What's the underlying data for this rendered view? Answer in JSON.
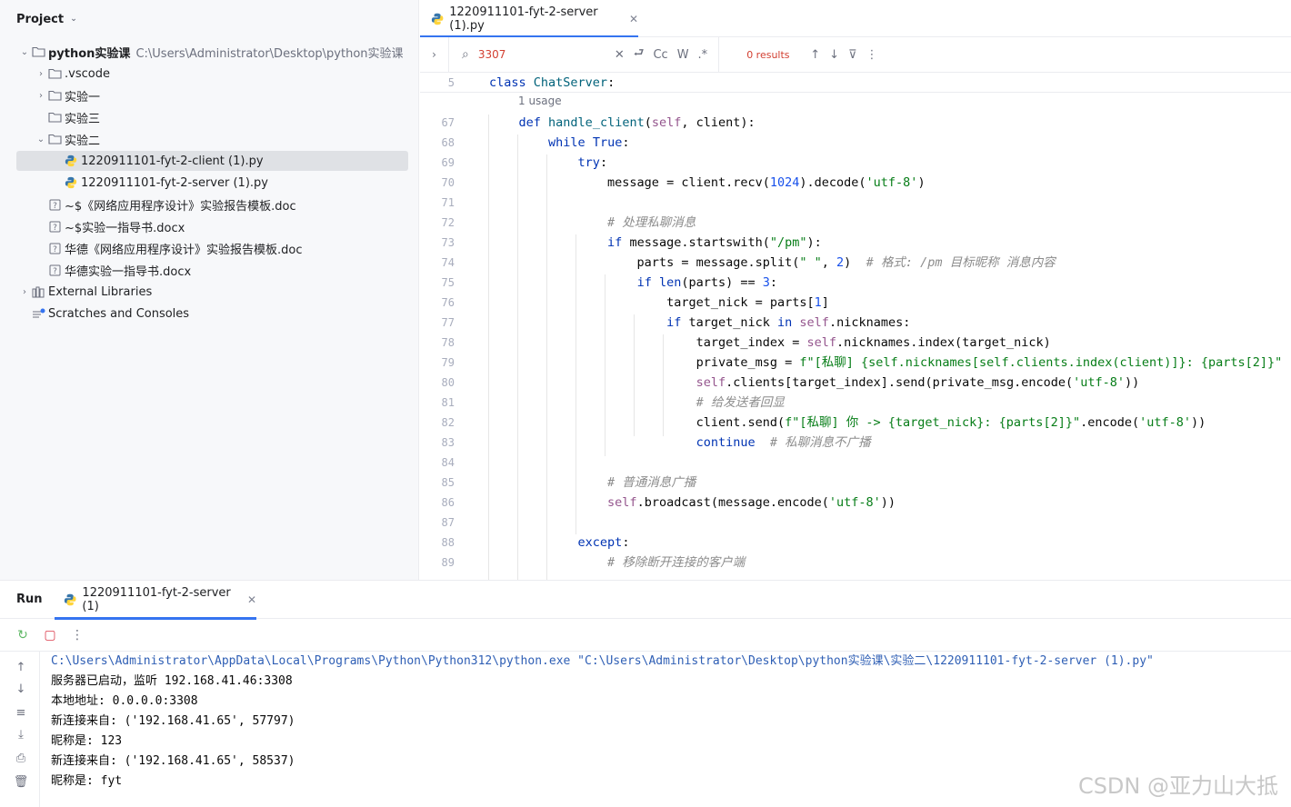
{
  "project": {
    "title": "Project",
    "tree": [
      {
        "label": "python实验课",
        "path": "C:\\Users\\Administrator\\Desktop\\python实验课",
        "icon": "folder-icon",
        "arrow": "down",
        "indent": 0,
        "bold": true
      },
      {
        "label": ".vscode",
        "icon": "folder-icon",
        "arrow": "right",
        "indent": 1
      },
      {
        "label": "实验一",
        "icon": "folder-icon",
        "arrow": "right",
        "indent": 1
      },
      {
        "label": "实验三",
        "icon": "folder-icon",
        "arrow": "none",
        "indent": 1
      },
      {
        "label": "实验二",
        "icon": "folder-icon",
        "arrow": "down",
        "indent": 1
      },
      {
        "label": "1220911101-fyt-2-client (1).py",
        "icon": "python-file-icon",
        "arrow": "none",
        "indent": 2,
        "selected": true
      },
      {
        "label": "1220911101-fyt-2-server (1).py",
        "icon": "python-file-icon",
        "arrow": "none",
        "indent": 2
      },
      {
        "label": "~$《网络应用程序设计》实验报告模板.doc",
        "icon": "unknown-file-icon",
        "arrow": "none",
        "indent": 1
      },
      {
        "label": "~$实验一指导书.docx",
        "icon": "unknown-file-icon",
        "arrow": "none",
        "indent": 1
      },
      {
        "label": "华德《网络应用程序设计》实验报告模板.doc",
        "icon": "unknown-file-icon",
        "arrow": "none",
        "indent": 1
      },
      {
        "label": "华德实验一指导书.docx",
        "icon": "unknown-file-icon",
        "arrow": "none",
        "indent": 1
      },
      {
        "label": "External Libraries",
        "icon": "library-icon",
        "arrow": "right",
        "indent": 0
      },
      {
        "label": "Scratches and Consoles",
        "icon": "scratches-icon",
        "arrow": "none",
        "indent": 0
      }
    ]
  },
  "editor": {
    "tab_label": "1220911101-fyt-2-server (1).py",
    "search": {
      "query": "3307",
      "results": "0 results",
      "match_case": "Cc",
      "words": "W",
      "regex": ".*"
    },
    "usage_hint": "1 usage",
    "sticky_line": {
      "num": "5",
      "code": "class ChatServer:"
    },
    "lines": [
      {
        "num": "67",
        "code": "    def handle_client(self, client):"
      },
      {
        "num": "68",
        "code": "        while True:"
      },
      {
        "num": "69",
        "code": "            try:"
      },
      {
        "num": "70",
        "code": "                message = client.recv(1024).decode('utf-8')"
      },
      {
        "num": "71",
        "code": ""
      },
      {
        "num": "72",
        "code": "                # 处理私聊消息"
      },
      {
        "num": "73",
        "code": "                if message.startswith(\"/pm\"):"
      },
      {
        "num": "74",
        "code": "                    parts = message.split(\" \", 2)  # 格式: /pm 目标昵称 消息内容"
      },
      {
        "num": "75",
        "code": "                    if len(parts) == 3:"
      },
      {
        "num": "76",
        "code": "                        target_nick = parts[1]"
      },
      {
        "num": "77",
        "code": "                        if target_nick in self.nicknames:"
      },
      {
        "num": "78",
        "code": "                            target_index = self.nicknames.index(target_nick)"
      },
      {
        "num": "79",
        "code": "                            private_msg = f\"[私聊] {self.nicknames[self.clients.index(client)]}: {parts[2]}\""
      },
      {
        "num": "80",
        "code": "                            self.clients[target_index].send(private_msg.encode('utf-8'))"
      },
      {
        "num": "81",
        "code": "                            # 给发送者回显"
      },
      {
        "num": "82",
        "code": "                            client.send(f\"[私聊] 你 -> {target_nick}: {parts[2]}\".encode('utf-8'))"
      },
      {
        "num": "83",
        "code": "                            continue  # 私聊消息不广播"
      },
      {
        "num": "84",
        "code": ""
      },
      {
        "num": "85",
        "code": "                # 普通消息广播"
      },
      {
        "num": "86",
        "code": "                self.broadcast(message.encode('utf-8'))"
      },
      {
        "num": "87",
        "code": ""
      },
      {
        "num": "88",
        "code": "            except:"
      },
      {
        "num": "89",
        "code": "                # 移除断开连接的客户端"
      }
    ]
  },
  "run": {
    "title": "Run",
    "tab_label": "1220911101-fyt-2-server (1)",
    "console": [
      "C:\\Users\\Administrator\\AppData\\Local\\Programs\\Python\\Python312\\python.exe \"C:\\Users\\Administrator\\Desktop\\python实验课\\实验二\\1220911101-fyt-2-server (1).py\"",
      "服务器已启动，监听 192.168.41.46:3308",
      "本地地址: 0.0.0.0:3308",
      "新连接来自: ('192.168.41.65', 57797)",
      "昵称是: 123",
      "新连接来自: ('192.168.41.65', 58537)",
      "昵称是: fyt"
    ]
  },
  "watermark": "CSDN @亚力山大抵",
  "colors": {
    "accent": "#3574f0",
    "keyword": "#0033b3",
    "string": "#067d17",
    "number": "#1750eb",
    "comment": "#8c8c8c",
    "self": "#94558d",
    "function": "#00627a",
    "search_miss": "#d23f31"
  }
}
